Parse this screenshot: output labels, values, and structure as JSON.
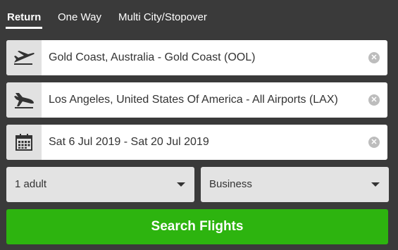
{
  "tabs": [
    {
      "label": "Return",
      "active": true
    },
    {
      "label": "One Way",
      "active": false
    },
    {
      "label": "Multi City/Stopover",
      "active": false
    }
  ],
  "origin": {
    "value": "Gold Coast, Australia - Gold Coast (OOL)",
    "icon": "plane-departure-icon"
  },
  "destination": {
    "value": "Los Angeles, United States Of America - All Airports (LAX)",
    "icon": "plane-arrival-icon"
  },
  "dates": {
    "value": "Sat 6 Jul 2019 - Sat 20 Jul 2019",
    "icon": "calendar-icon"
  },
  "passengers": {
    "value": "1 adult"
  },
  "cabin_class": {
    "value": "Business"
  },
  "search_button": {
    "label": "Search Flights"
  },
  "colors": {
    "background": "#3a3a3a",
    "accent": "#2db40f"
  }
}
